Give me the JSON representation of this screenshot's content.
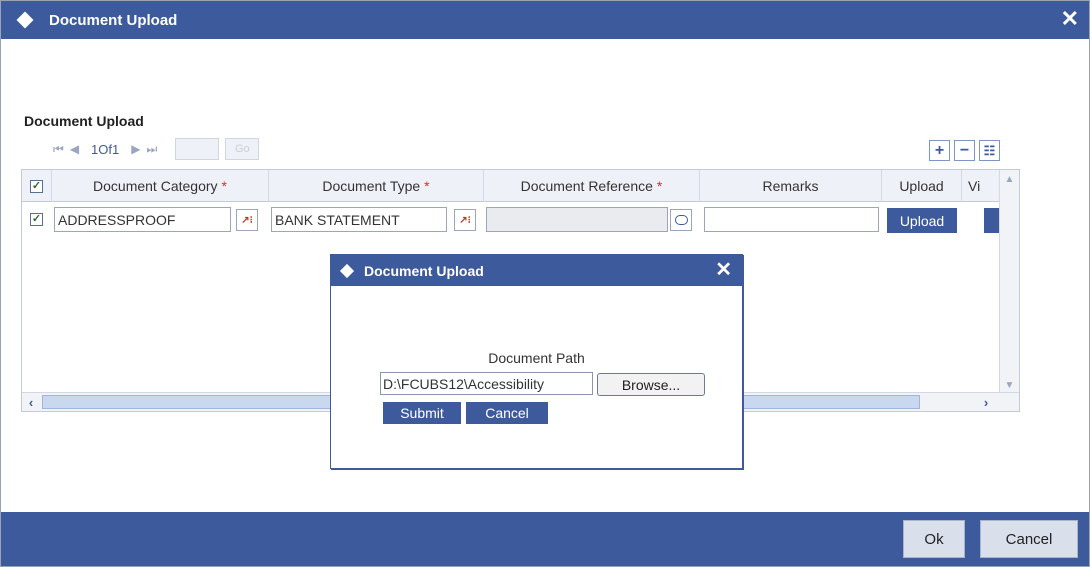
{
  "window": {
    "title": "Document Upload",
    "close_glyph": "✕"
  },
  "section": {
    "label": "Document Upload"
  },
  "pagination": {
    "first_glyph": "⏮",
    "prev_glyph": "◀",
    "page_text": "1Of1",
    "next_glyph": "▶",
    "last_glyph": "⏭",
    "go_label": "Go"
  },
  "toolbar": {
    "add_glyph": "+",
    "remove_glyph": "−",
    "view_glyph": "☷"
  },
  "grid": {
    "columns": [
      {
        "label": "Document Category",
        "required": "*"
      },
      {
        "label": "Document Type",
        "required": "*"
      },
      {
        "label": "Document Reference",
        "required": "*"
      },
      {
        "label": "Remarks",
        "required": ""
      },
      {
        "label": "Upload",
        "required": ""
      },
      {
        "label": "Vi",
        "required": ""
      }
    ],
    "rows": [
      {
        "checked": true,
        "category": "ADDRESSPROOF",
        "type": "BANK STATEMENT",
        "reference": "",
        "remarks": "",
        "upload_label": "Upload"
      }
    ]
  },
  "dialog": {
    "title": "Document Upload",
    "close_glyph": "✕",
    "path_label": "Document Path",
    "path_value": "D:\\FCUBS12\\Accessibility",
    "browse_label": "Browse...",
    "submit_label": "Submit",
    "cancel_label": "Cancel"
  },
  "footer": {
    "ok_label": "Ok",
    "cancel_label": "Cancel"
  },
  "colors": {
    "brand": "#3d5b9c",
    "required": "#d0322a"
  }
}
